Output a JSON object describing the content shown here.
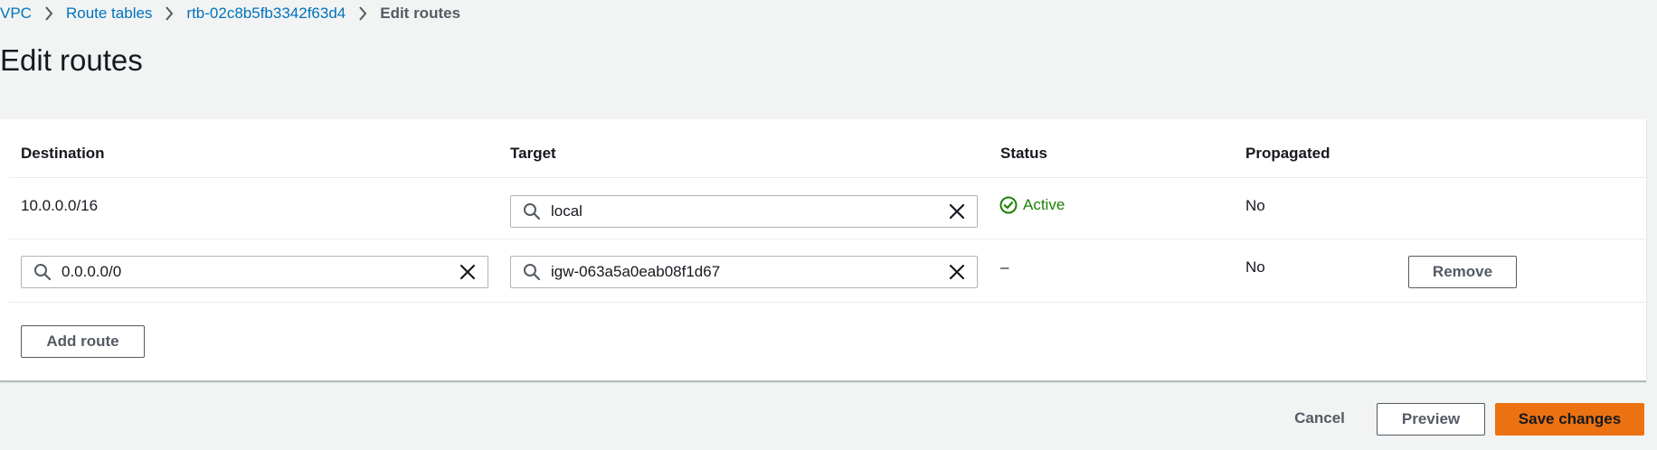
{
  "breadcrumb": {
    "items": [
      "VPC",
      "Route tables",
      "rtb-02c8b5fb3342f63d4"
    ],
    "current": "Edit routes"
  },
  "page_title": "Edit routes",
  "table": {
    "headers": {
      "destination": "Destination",
      "target": "Target",
      "status": "Status",
      "propagated": "Propagated"
    },
    "rows": [
      {
        "destination": "10.0.0.0/16",
        "target": "local",
        "status": "Active",
        "propagated": "No"
      },
      {
        "destination": "0.0.0.0/0",
        "target": "igw-063a5a0eab08f1d67",
        "status": "–",
        "propagated": "No",
        "remove_label": "Remove"
      }
    ],
    "add_route_label": "Add route"
  },
  "footer": {
    "cancel_label": "Cancel",
    "preview_label": "Preview",
    "save_label": "Save changes"
  },
  "colors": {
    "link": "#0073bb",
    "active_status": "#1d8102",
    "primary_button": "#ec7211",
    "page_background": "#f2f3f3"
  },
  "icons": {
    "breadcrumb_separator": "chevron-right-icon",
    "search": "search-icon",
    "clear": "close-icon",
    "status_active": "check-circle-icon"
  }
}
